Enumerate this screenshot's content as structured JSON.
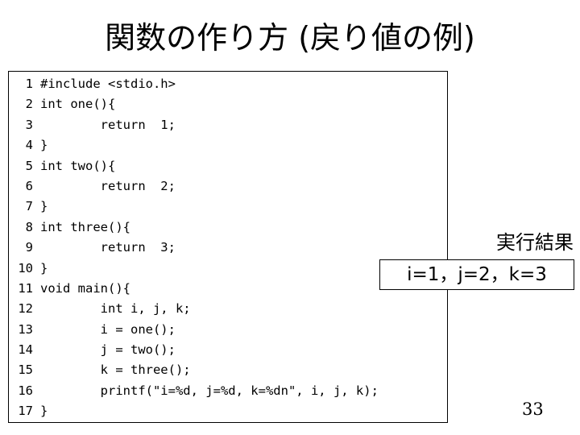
{
  "slide": {
    "title": "関数の作り方 (戻り値の例)",
    "page_number": "33",
    "background_color": "#ffffff",
    "text_color": "#000000"
  },
  "code_block": {
    "border_color": "#000000",
    "language": "c",
    "lines": [
      {
        "number": "1",
        "text": "#include <stdio.h>"
      },
      {
        "number": "2",
        "text": "int one(){"
      },
      {
        "number": "3",
        "text": "        return  1;"
      },
      {
        "number": "4",
        "text": "}"
      },
      {
        "number": "5",
        "text": "int two(){"
      },
      {
        "number": "6",
        "text": "        return  2;"
      },
      {
        "number": "7",
        "text": "}"
      },
      {
        "number": "8",
        "text": "int three(){"
      },
      {
        "number": "9",
        "text": "        return  3;"
      },
      {
        "number": "10",
        "text": "}"
      },
      {
        "number": "11",
        "text": "void main(){"
      },
      {
        "number": "12",
        "text": "        int i, j, k;"
      },
      {
        "number": "13",
        "text": "        i = one();"
      },
      {
        "number": "14",
        "text": "        j = two();"
      },
      {
        "number": "15",
        "text": "        k = three();"
      },
      {
        "number": "16",
        "text": "        printf(\"i=%d, j=%d, k=%dn\", i, j, k);"
      },
      {
        "number": "17",
        "text": "}"
      }
    ]
  },
  "result": {
    "label": "実行結果",
    "output_text": "i=1，j=2，k=3",
    "border_color": "#000000"
  }
}
